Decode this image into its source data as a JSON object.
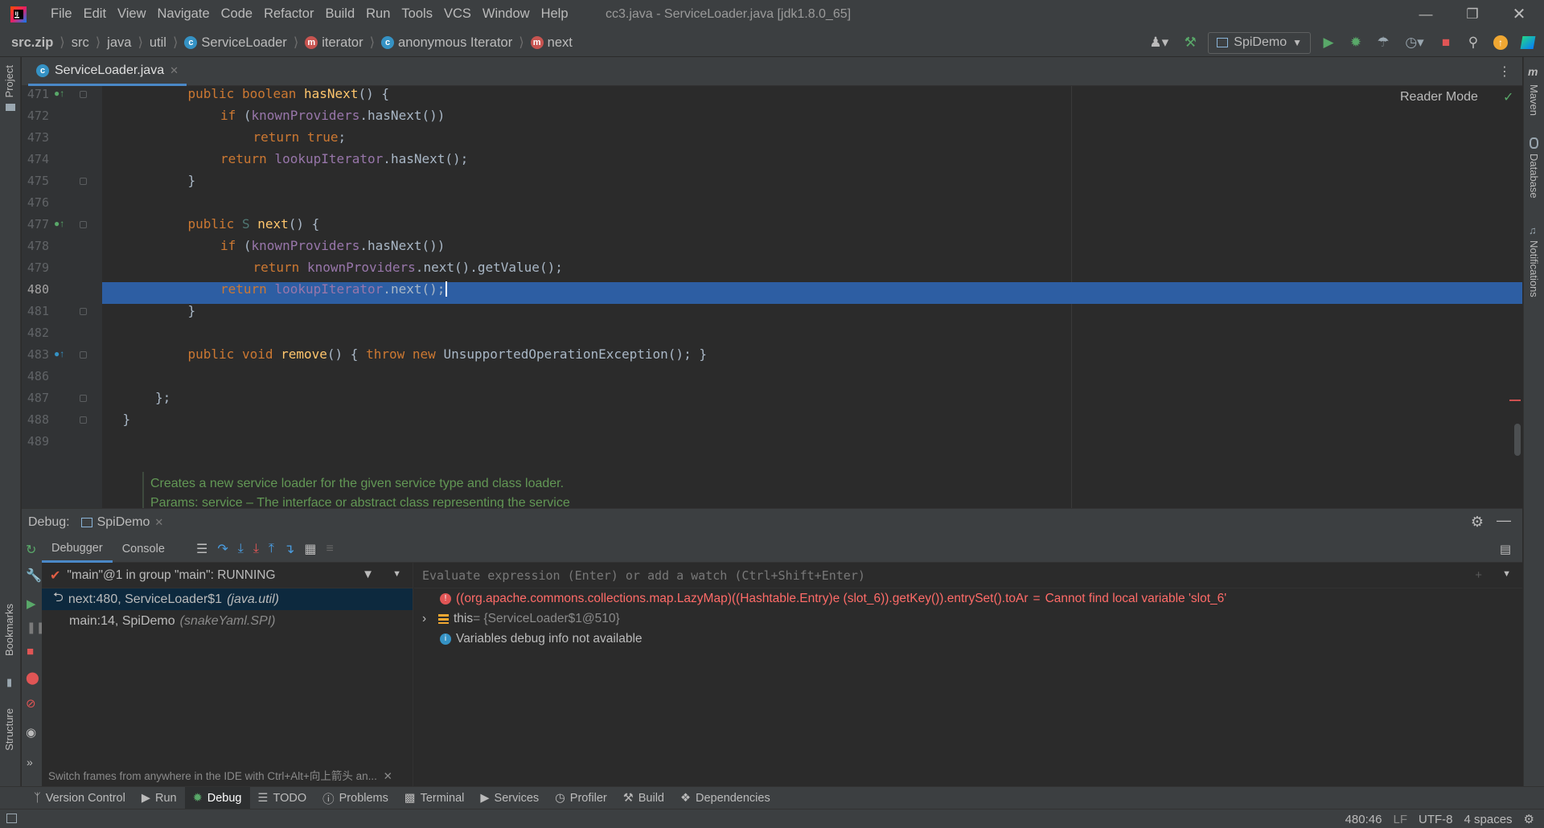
{
  "menu": [
    "File",
    "Edit",
    "View",
    "Navigate",
    "Code",
    "Refactor",
    "Build",
    "Run",
    "Tools",
    "VCS",
    "Window",
    "Help"
  ],
  "window_title": "cc3.java - ServiceLoader.java [jdk1.8.0_65]",
  "breadcrumbs": {
    "root": "src.zip",
    "items": [
      "src",
      "java",
      "util"
    ],
    "class": "ServiceLoader",
    "method1": "iterator",
    "anon": "anonymous Iterator",
    "method2": "next"
  },
  "run_config": "SpiDemo",
  "editor_tab": "ServiceLoader.java",
  "reader_mode": "Reader Mode",
  "code_lines": [
    {
      "n": "471",
      "text": "public boolean hasNext() {"
    },
    {
      "n": "472",
      "text": "if (knownProviders.hasNext())"
    },
    {
      "n": "473",
      "text": "return true;"
    },
    {
      "n": "474",
      "text": "return lookupIterator.hasNext();"
    },
    {
      "n": "475",
      "text": "}"
    },
    {
      "n": "476",
      "text": ""
    },
    {
      "n": "477",
      "text": "public S next() {"
    },
    {
      "n": "478",
      "text": "if (knownProviders.hasNext())"
    },
    {
      "n": "479",
      "text": "return knownProviders.next().getValue();"
    },
    {
      "n": "480",
      "text": "return lookupIterator.next();"
    },
    {
      "n": "481",
      "text": "}"
    },
    {
      "n": "482",
      "text": ""
    },
    {
      "n": "483",
      "text": "public void remove() { throw new UnsupportedOperationException(); }"
    },
    {
      "n": "486",
      "text": ""
    },
    {
      "n": "487",
      "text": "};"
    },
    {
      "n": "488",
      "text": "}"
    },
    {
      "n": "489",
      "text": ""
    }
  ],
  "doc_comment": "Creates a new service loader for the given service type and class loader.",
  "doc_params": "Params: service – The interface or abstract class representing the service",
  "debug": {
    "label": "Debug:",
    "session": "SpiDemo",
    "tab_debugger": "Debugger",
    "tab_console": "Console",
    "thread": "\"main\"@1 in group \"main\": RUNNING",
    "frames": [
      {
        "name": "next:480, ServiceLoader$1",
        "pkg": "(java.util)"
      },
      {
        "name": "main:14, SpiDemo",
        "pkg": "(snakeYaml.SPI)"
      }
    ],
    "hint": "Switch frames from anywhere in the IDE with Ctrl+Alt+向上箭头 an...",
    "eval_placeholder": "Evaluate expression (Enter) or add a watch (Ctrl+Shift+Enter)",
    "var_error_expr": "((org.apache.commons.collections.map.LazyMap)((Hashtable.Entry)e (slot_6)).getKey()).entrySet().toAr",
    "var_error_eq": " = ",
    "var_error_msg": "Cannot find local variable 'slot_6'",
    "var_this_name": "this",
    "var_this_value": " = {ServiceLoader$1@510}",
    "var_info": "Variables debug info not available"
  },
  "left_tabs": {
    "project": "Project",
    "bookmarks": "Bookmarks",
    "structure": "Structure"
  },
  "right_tabs": {
    "maven": "Maven",
    "database": "Database",
    "notifications": "Notifications"
  },
  "bottom_tabs": [
    "Version Control",
    "Run",
    "Debug",
    "TODO",
    "Problems",
    "Terminal",
    "Services",
    "Profiler",
    "Build",
    "Dependencies"
  ],
  "status": {
    "position": "480:46",
    "line_sep": "LF",
    "encoding": "UTF-8",
    "indent": "4 spaces"
  },
  "colors": {
    "selection": "#2d5ea3",
    "accent": "#4a88c7",
    "error": "#ff6b68",
    "run_green": "#59a869",
    "stop_red": "#e05555"
  }
}
